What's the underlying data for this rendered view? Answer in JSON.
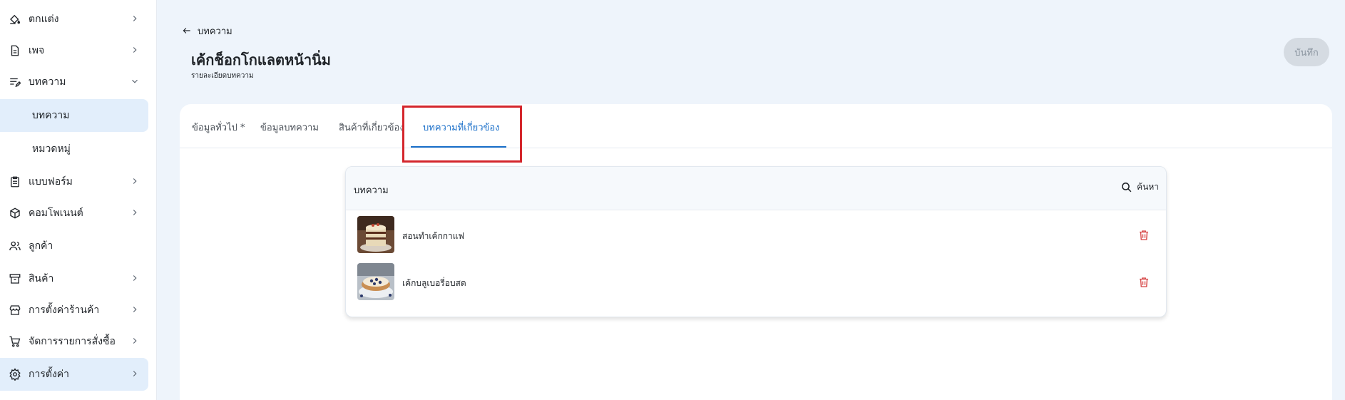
{
  "sidebar": {
    "items": [
      {
        "label": "ตกแต่ง",
        "icon": "paint-bucket-icon"
      },
      {
        "label": "เพจ",
        "icon": "page-icon"
      },
      {
        "label": "บทความ",
        "icon": "article-edit-icon"
      },
      {
        "label": "บทความ",
        "icon": ""
      },
      {
        "label": "หมวดหมู่",
        "icon": ""
      },
      {
        "label": "แบบฟอร์ม",
        "icon": "form-icon"
      },
      {
        "label": "คอมโพเนนต์",
        "icon": "cube-icon"
      },
      {
        "label": "ลูกค้า",
        "icon": "users-icon"
      },
      {
        "label": "สินค้า",
        "icon": "box-icon"
      },
      {
        "label": "การตั้งค่าร้านค้า",
        "icon": "store-icon"
      },
      {
        "label": "จัดการรายการสั่งซื้อ",
        "icon": "cart-icon"
      },
      {
        "label": "การตั้งค่า",
        "icon": "gear-icon"
      }
    ]
  },
  "header": {
    "back_label": "บทความ",
    "title": "เค้กช็อกโกแลตหน้านิ่ม",
    "subtitle": "รายละเอียดบทความ",
    "save_label": "บันทึก"
  },
  "tabs": [
    {
      "label": "ข้อมูลทั่วไป *"
    },
    {
      "label": "ข้อมูลบทความ"
    },
    {
      "label": "สินค้าที่เกี่ยวข้อง"
    },
    {
      "label": "บทความที่เกี่ยวข้อง",
      "active": true
    }
  ],
  "related": {
    "title": "บทความ",
    "search_label": "ค้นหา",
    "items": [
      {
        "label": "สอนทำเค้กกาแฟ"
      },
      {
        "label": "เค้กบลูเบอรี่อบสด"
      }
    ]
  },
  "colors": {
    "accent": "#1a6fc9",
    "highlight": "#d4262c",
    "delete": "#d64545"
  }
}
